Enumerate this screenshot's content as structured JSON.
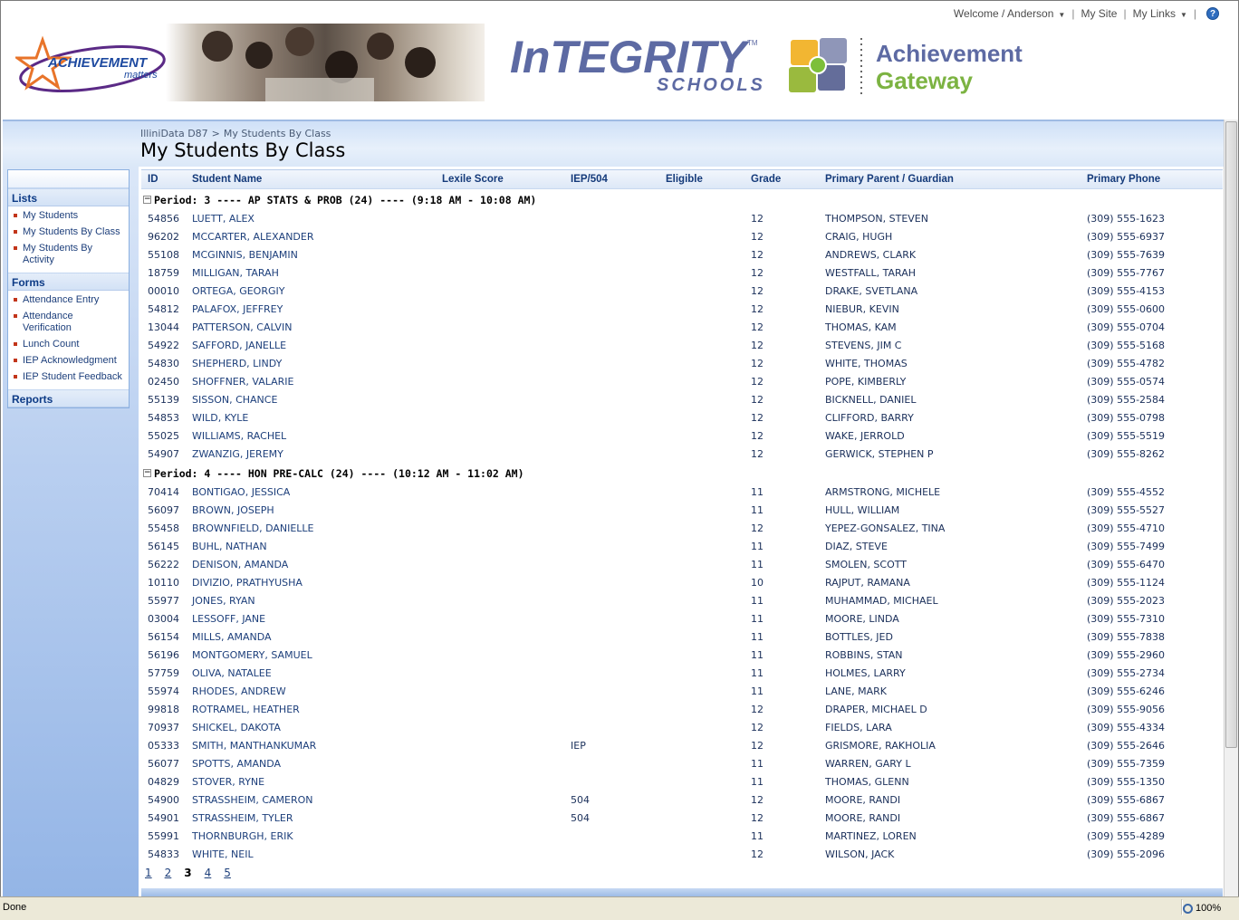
{
  "toplinks": {
    "welcome": "Welcome / Anderson",
    "my_site": "My Site",
    "my_links": "My Links",
    "help": "?"
  },
  "banner": {
    "logo_text_main": "ACHIEVEMENT",
    "logo_text_sub": "matters",
    "integrity_main": "InTEGRITY",
    "integrity_tm": "TM",
    "integrity_sub": "SCHOOLS",
    "gateway_line1": "Achievement",
    "gateway_line2": "Gateway"
  },
  "breadcrumb": {
    "root": "IlliniData D87",
    "separator": ">",
    "current": "My Students By Class"
  },
  "page_title": "My Students By Class",
  "quicklaunch": {
    "sections": [
      {
        "title": "Lists",
        "items": [
          "My Students",
          "My Students By Class",
          "My Students By Activity"
        ]
      },
      {
        "title": "Forms",
        "items": [
          "Attendance Entry",
          "Attendance Verification",
          "Lunch Count",
          "IEP Acknowledgment",
          "IEP Student Feedback"
        ]
      },
      {
        "title": "Reports",
        "items": []
      }
    ]
  },
  "grid": {
    "columns": [
      "ID",
      "Student Name",
      "Lexile Score",
      "IEP/504",
      "Eligible",
      "Grade",
      "Primary Parent / Guardian",
      "Primary Phone"
    ],
    "groups": [
      {
        "label": "Period: 3 ---- AP STATS & PROB (24) ---- (9:18 AM - 10:08 AM)",
        "toggle": "−",
        "rows": [
          [
            "54856",
            "LUETT, ALEX",
            "",
            "",
            "",
            "12",
            "THOMPSON, STEVEN",
            "(309) 555-1623"
          ],
          [
            "96202",
            "MCCARTER, ALEXANDER",
            "",
            "",
            "",
            "12",
            "CRAIG, HUGH",
            "(309) 555-6937"
          ],
          [
            "55108",
            "MCGINNIS, BENJAMIN",
            "",
            "",
            "",
            "12",
            "ANDREWS, CLARK",
            "(309) 555-7639"
          ],
          [
            "18759",
            "MILLIGAN, TARAH",
            "",
            "",
            "",
            "12",
            "WESTFALL, TARAH",
            "(309) 555-7767"
          ],
          [
            "00010",
            "ORTEGA, GEORGIY",
            "",
            "",
            "",
            "12",
            "DRAKE, SVETLANA",
            "(309) 555-4153"
          ],
          [
            "54812",
            "PALAFOX, JEFFREY",
            "",
            "",
            "",
            "12",
            "NIEBUR, KEVIN",
            "(309) 555-0600"
          ],
          [
            "13044",
            "PATTERSON, CALVIN",
            "",
            "",
            "",
            "12",
            "THOMAS, KAM",
            "(309) 555-0704"
          ],
          [
            "54922",
            "SAFFORD, JANELLE",
            "",
            "",
            "",
            "12",
            "STEVENS, JIM C",
            "(309) 555-5168"
          ],
          [
            "54830",
            "SHEPHERD, LINDY",
            "",
            "",
            "",
            "12",
            "WHITE, THOMAS",
            "(309) 555-4782"
          ],
          [
            "02450",
            "SHOFFNER, VALARIE",
            "",
            "",
            "",
            "12",
            "POPE, KIMBERLY",
            "(309) 555-0574"
          ],
          [
            "55139",
            "SISSON, CHANCE",
            "",
            "",
            "",
            "12",
            "BICKNELL, DANIEL",
            "(309) 555-2584"
          ],
          [
            "54853",
            "WILD, KYLE",
            "",
            "",
            "",
            "12",
            "CLIFFORD, BARRY",
            "(309) 555-0798"
          ],
          [
            "55025",
            "WILLIAMS, RACHEL",
            "",
            "",
            "",
            "12",
            "WAKE, JERROLD",
            "(309) 555-5519"
          ],
          [
            "54907",
            "ZWANZIG, JEREMY",
            "",
            "",
            "",
            "12",
            "GERWICK, STEPHEN P",
            "(309) 555-8262"
          ]
        ]
      },
      {
        "label": "Period: 4 ---- HON PRE-CALC (24) ---- (10:12 AM - 11:02 AM)",
        "toggle": "−",
        "rows": [
          [
            "70414",
            "BONTIGAO, JESSICA",
            "",
            "",
            "",
            "11",
            "ARMSTRONG, MICHELE",
            "(309) 555-4552"
          ],
          [
            "56097",
            "BROWN, JOSEPH",
            "",
            "",
            "",
            "11",
            "HULL, WILLIAM",
            "(309) 555-5527"
          ],
          [
            "55458",
            "BROWNFIELD, DANIELLE",
            "",
            "",
            "",
            "12",
            "YEPEZ-GONSALEZ, TINA",
            "(309) 555-4710"
          ],
          [
            "56145",
            "BUHL, NATHAN",
            "",
            "",
            "",
            "11",
            "DIAZ, STEVE",
            "(309) 555-7499"
          ],
          [
            "56222",
            "DENISON, AMANDA",
            "",
            "",
            "",
            "11",
            "SMOLEN, SCOTT",
            "(309) 555-6470"
          ],
          [
            "10110",
            "DIVIZIO, PRATHYUSHA",
            "",
            "",
            "",
            "10",
            "RAJPUT, RAMANA",
            "(309) 555-1124"
          ],
          [
            "55977",
            "JONES, RYAN",
            "",
            "",
            "",
            "11",
            "MUHAMMAD, MICHAEL",
            "(309) 555-2023"
          ],
          [
            "03004",
            "LESSOFF, JANE",
            "",
            "",
            "",
            "11",
            "MOORE, LINDA",
            "(309) 555-7310"
          ],
          [
            "56154",
            "MILLS, AMANDA",
            "",
            "",
            "",
            "11",
            "BOTTLES, JED",
            "(309) 555-7838"
          ],
          [
            "56196",
            "MONTGOMERY, SAMUEL",
            "",
            "",
            "",
            "11",
            "ROBBINS, STAN",
            "(309) 555-2960"
          ],
          [
            "57759",
            "OLIVA, NATALEE",
            "",
            "",
            "",
            "11",
            "HOLMES, LARRY",
            "(309) 555-2734"
          ],
          [
            "55974",
            "RHODES, ANDREW",
            "",
            "",
            "",
            "11",
            "LANE, MARK",
            "(309) 555-6246"
          ],
          [
            "99818",
            "ROTRAMEL, HEATHER",
            "",
            "",
            "",
            "12",
            "DRAPER, MICHAEL D",
            "(309) 555-9056"
          ],
          [
            "70937",
            "SHICKEL, DAKOTA",
            "",
            "",
            "",
            "12",
            "FIELDS, LARA",
            "(309) 555-4334"
          ],
          [
            "05333",
            "SMITH, MANTHANKUMAR",
            "",
            "IEP",
            "",
            "12",
            "GRISMORE, RAKHOLIA",
            "(309) 555-2646"
          ],
          [
            "56077",
            "SPOTTS, AMANDA",
            "",
            "",
            "",
            "11",
            "WARREN, GARY L",
            "(309) 555-7359"
          ],
          [
            "04829",
            "STOVER, RYNE",
            "",
            "",
            "",
            "11",
            "THOMAS, GLENN",
            "(309) 555-1350"
          ],
          [
            "54900",
            "STRASSHEIM, CAMERON",
            "",
            "504",
            "",
            "12",
            "MOORE, RANDI",
            "(309) 555-6867"
          ],
          [
            "54901",
            "STRASSHEIM, TYLER",
            "",
            "504",
            "",
            "12",
            "MOORE, RANDI",
            "(309) 555-6867"
          ],
          [
            "55991",
            "THORNBURGH, ERIK",
            "",
            "",
            "",
            "11",
            "MARTINEZ, LOREN",
            "(309) 555-4289"
          ],
          [
            "54833",
            "WHITE, NEIL",
            "",
            "",
            "",
            "12",
            "WILSON, JACK",
            "(309) 555-2096"
          ]
        ]
      }
    ]
  },
  "pager": {
    "pages": [
      "1",
      "2",
      "3",
      "4",
      "5"
    ],
    "current": "3"
  },
  "statusbar": {
    "text": "Done",
    "zoom": "100%"
  },
  "colors": {
    "accent": "#143a7a",
    "link": "#1d3f7b",
    "band": "#cfe0f7",
    "bullet": "#c2351a"
  }
}
